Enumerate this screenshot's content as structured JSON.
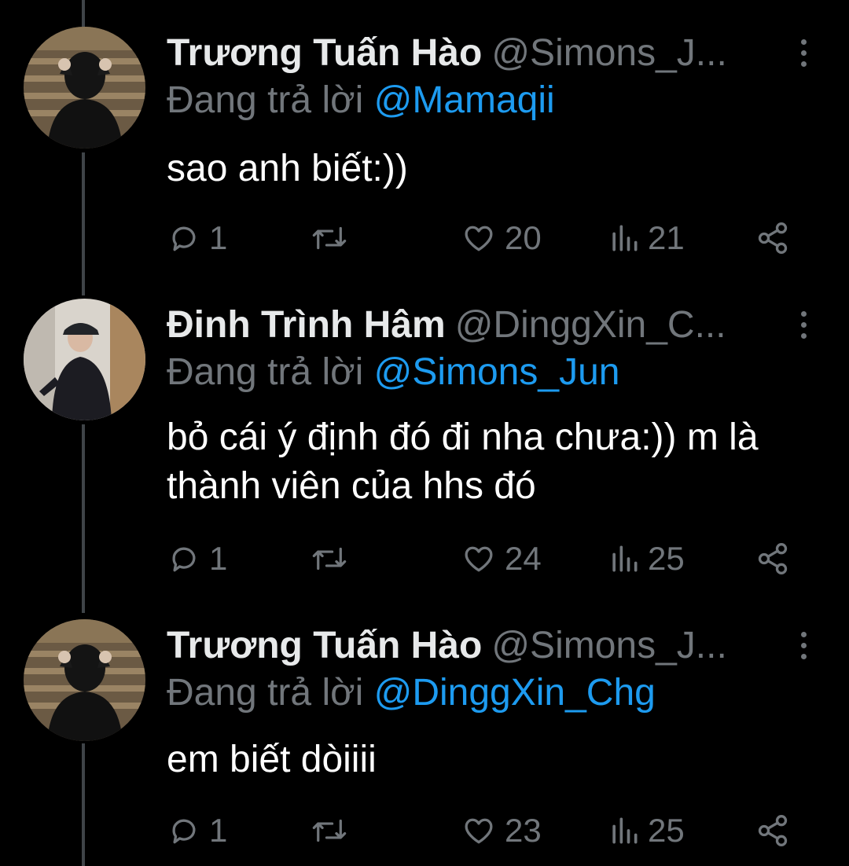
{
  "colors": {
    "background": "#000000",
    "name": "#e7e9ea",
    "text": "#ffffff",
    "muted": "#71767b",
    "accent": "#1d9bf0",
    "thread_line": "#3f4448"
  },
  "tweets": [
    {
      "name": "Trương Tuấn Hào",
      "handle": "@Simons_J...",
      "reply_prefix": "Đang trả lời",
      "reply_to": "@Mamaqii",
      "text": "sao anh biết:))",
      "replies": "1",
      "likes": "20",
      "views": "21",
      "avatar": "avatar-user-simons"
    },
    {
      "name": "Đinh Trình Hâm",
      "handle": "@DinggXin_C...",
      "reply_prefix": "Đang trả lời",
      "reply_to": "@Simons_Jun",
      "text": "bỏ cái ý định đó đi nha chưa:)) m là thành viên của hhs đó",
      "replies": "1",
      "likes": "24",
      "views": "25",
      "avatar": "avatar-user-dinggxin"
    },
    {
      "name": "Trương Tuấn Hào",
      "handle": "@Simons_J...",
      "reply_prefix": "Đang trả lời",
      "reply_to": "@DinggXin_Chg",
      "text": "em biết dòiiii",
      "replies": "1",
      "likes": "23",
      "views": "25",
      "avatar": "avatar-user-simons"
    }
  ],
  "icons": {
    "reply": "reply-icon",
    "retweet": "retweet-icon",
    "like": "heart-icon",
    "views": "views-icon",
    "share": "share-icon",
    "more": "more-vertical-icon"
  }
}
